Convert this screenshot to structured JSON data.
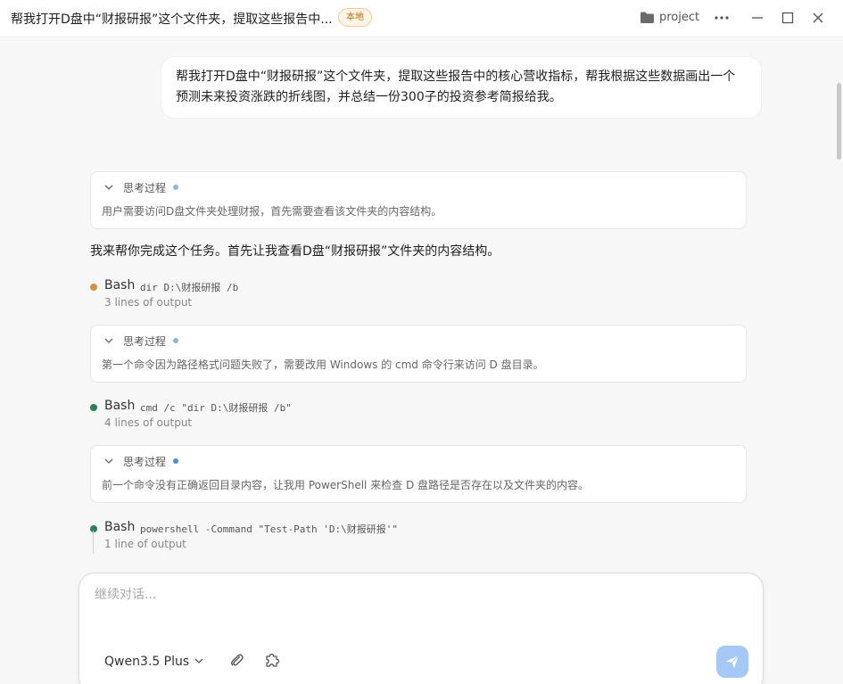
{
  "titlebar": {
    "title": "帮我打开D盘中“财报研报”这个文件夹，提取这些报告中...",
    "badge": "本地",
    "project": "project",
    "icons": [
      "folder-icon",
      "more-icon",
      "minimize-icon",
      "maximize-icon",
      "close-icon"
    ]
  },
  "chat": {
    "user_message": "帮我打开D盘中“财报研报”这个文件夹，提取这些报告中的核心营收指标，帮我根据这些数据画出一个预测未来投资涨跌的折线图，并总结一份300子的投资参考简报给我。",
    "thinking": [
      {
        "title": "思考过程",
        "body": "用户需要访问D盘文件夹处理财报，首先需要查看该文件夹的内容结构。",
        "dot_color": "#8ab4e8"
      },
      {
        "title": "思考过程",
        "body": "第一个命令因为路径格式问题失败了，需要改用 Windows 的 cmd 命令行来访问 D 盘目录。",
        "dot_color": "#8ab4e8"
      },
      {
        "title": "思考过程",
        "body": "前一个命令没有正确返回目录内容，让我用 PowerShell 来检查 D 盘路径是否存在以及文件夹的内容。",
        "dot_color": "#4a8fe0"
      }
    ],
    "assistant_text": "我来帮你完成这个任务。首先让我查看D盘“财报研报”文件夹的内容结构。",
    "tools": [
      {
        "name": "Bash",
        "command": "dir D:\\财报研报 /b",
        "output": "3 lines of output",
        "status_color": "#d4914a"
      },
      {
        "name": "Bash",
        "command": "cmd /c \"dir D:\\财报研报 /b\"",
        "output": "4 lines of output",
        "status_color": "#2e7d5b"
      },
      {
        "name": "Bash",
        "command": "powershell -Command \"Test-Path 'D:\\财报研报'\"",
        "output": "1 line of output",
        "status_color": "#2e7d5b"
      }
    ]
  },
  "input": {
    "placeholder": "继续对话...",
    "model": "Qwen3.5 Plus",
    "send_color": "#a6c8f7"
  }
}
